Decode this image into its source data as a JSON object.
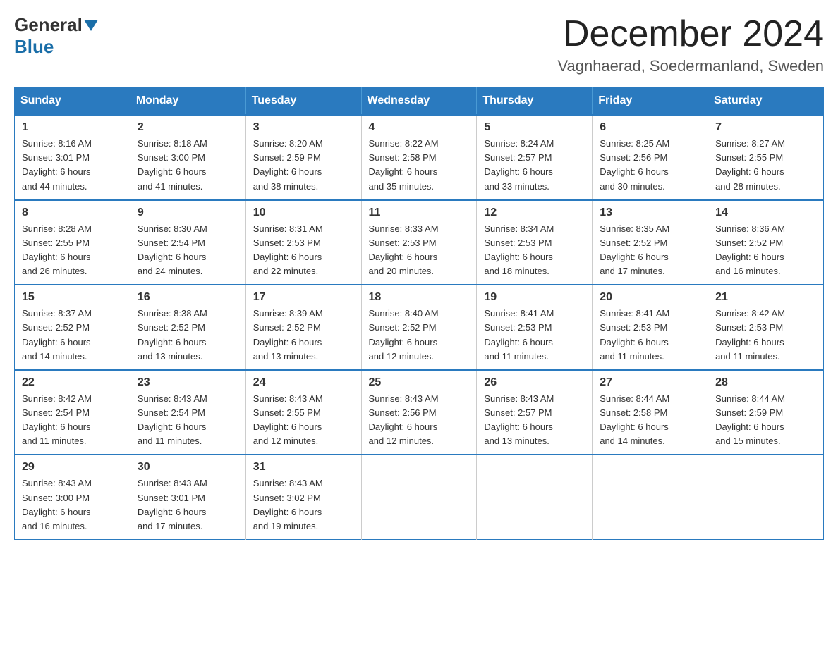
{
  "logo": {
    "general": "General",
    "blue": "Blue"
  },
  "title": {
    "month_year": "December 2024",
    "location": "Vagnhaerad, Soedermanland, Sweden"
  },
  "weekdays": [
    "Sunday",
    "Monday",
    "Tuesday",
    "Wednesday",
    "Thursday",
    "Friday",
    "Saturday"
  ],
  "weeks": [
    [
      {
        "day": "1",
        "sunrise": "8:16 AM",
        "sunset": "3:01 PM",
        "daylight": "6 hours and 44 minutes."
      },
      {
        "day": "2",
        "sunrise": "8:18 AM",
        "sunset": "3:00 PM",
        "daylight": "6 hours and 41 minutes."
      },
      {
        "day": "3",
        "sunrise": "8:20 AM",
        "sunset": "2:59 PM",
        "daylight": "6 hours and 38 minutes."
      },
      {
        "day": "4",
        "sunrise": "8:22 AM",
        "sunset": "2:58 PM",
        "daylight": "6 hours and 35 minutes."
      },
      {
        "day": "5",
        "sunrise": "8:24 AM",
        "sunset": "2:57 PM",
        "daylight": "6 hours and 33 minutes."
      },
      {
        "day": "6",
        "sunrise": "8:25 AM",
        "sunset": "2:56 PM",
        "daylight": "6 hours and 30 minutes."
      },
      {
        "day": "7",
        "sunrise": "8:27 AM",
        "sunset": "2:55 PM",
        "daylight": "6 hours and 28 minutes."
      }
    ],
    [
      {
        "day": "8",
        "sunrise": "8:28 AM",
        "sunset": "2:55 PM",
        "daylight": "6 hours and 26 minutes."
      },
      {
        "day": "9",
        "sunrise": "8:30 AM",
        "sunset": "2:54 PM",
        "daylight": "6 hours and 24 minutes."
      },
      {
        "day": "10",
        "sunrise": "8:31 AM",
        "sunset": "2:53 PM",
        "daylight": "6 hours and 22 minutes."
      },
      {
        "day": "11",
        "sunrise": "8:33 AM",
        "sunset": "2:53 PM",
        "daylight": "6 hours and 20 minutes."
      },
      {
        "day": "12",
        "sunrise": "8:34 AM",
        "sunset": "2:53 PM",
        "daylight": "6 hours and 18 minutes."
      },
      {
        "day": "13",
        "sunrise": "8:35 AM",
        "sunset": "2:52 PM",
        "daylight": "6 hours and 17 minutes."
      },
      {
        "day": "14",
        "sunrise": "8:36 AM",
        "sunset": "2:52 PM",
        "daylight": "6 hours and 16 minutes."
      }
    ],
    [
      {
        "day": "15",
        "sunrise": "8:37 AM",
        "sunset": "2:52 PM",
        "daylight": "6 hours and 14 minutes."
      },
      {
        "day": "16",
        "sunrise": "8:38 AM",
        "sunset": "2:52 PM",
        "daylight": "6 hours and 13 minutes."
      },
      {
        "day": "17",
        "sunrise": "8:39 AM",
        "sunset": "2:52 PM",
        "daylight": "6 hours and 13 minutes."
      },
      {
        "day": "18",
        "sunrise": "8:40 AM",
        "sunset": "2:52 PM",
        "daylight": "6 hours and 12 minutes."
      },
      {
        "day": "19",
        "sunrise": "8:41 AM",
        "sunset": "2:53 PM",
        "daylight": "6 hours and 11 minutes."
      },
      {
        "day": "20",
        "sunrise": "8:41 AM",
        "sunset": "2:53 PM",
        "daylight": "6 hours and 11 minutes."
      },
      {
        "day": "21",
        "sunrise": "8:42 AM",
        "sunset": "2:53 PM",
        "daylight": "6 hours and 11 minutes."
      }
    ],
    [
      {
        "day": "22",
        "sunrise": "8:42 AM",
        "sunset": "2:54 PM",
        "daylight": "6 hours and 11 minutes."
      },
      {
        "day": "23",
        "sunrise": "8:43 AM",
        "sunset": "2:54 PM",
        "daylight": "6 hours and 11 minutes."
      },
      {
        "day": "24",
        "sunrise": "8:43 AM",
        "sunset": "2:55 PM",
        "daylight": "6 hours and 12 minutes."
      },
      {
        "day": "25",
        "sunrise": "8:43 AM",
        "sunset": "2:56 PM",
        "daylight": "6 hours and 12 minutes."
      },
      {
        "day": "26",
        "sunrise": "8:43 AM",
        "sunset": "2:57 PM",
        "daylight": "6 hours and 13 minutes."
      },
      {
        "day": "27",
        "sunrise": "8:44 AM",
        "sunset": "2:58 PM",
        "daylight": "6 hours and 14 minutes."
      },
      {
        "day": "28",
        "sunrise": "8:44 AM",
        "sunset": "2:59 PM",
        "daylight": "6 hours and 15 minutes."
      }
    ],
    [
      {
        "day": "29",
        "sunrise": "8:43 AM",
        "sunset": "3:00 PM",
        "daylight": "6 hours and 16 minutes."
      },
      {
        "day": "30",
        "sunrise": "8:43 AM",
        "sunset": "3:01 PM",
        "daylight": "6 hours and 17 minutes."
      },
      {
        "day": "31",
        "sunrise": "8:43 AM",
        "sunset": "3:02 PM",
        "daylight": "6 hours and 19 minutes."
      },
      null,
      null,
      null,
      null
    ]
  ],
  "labels": {
    "sunrise": "Sunrise:",
    "sunset": "Sunset:",
    "daylight": "Daylight:"
  }
}
